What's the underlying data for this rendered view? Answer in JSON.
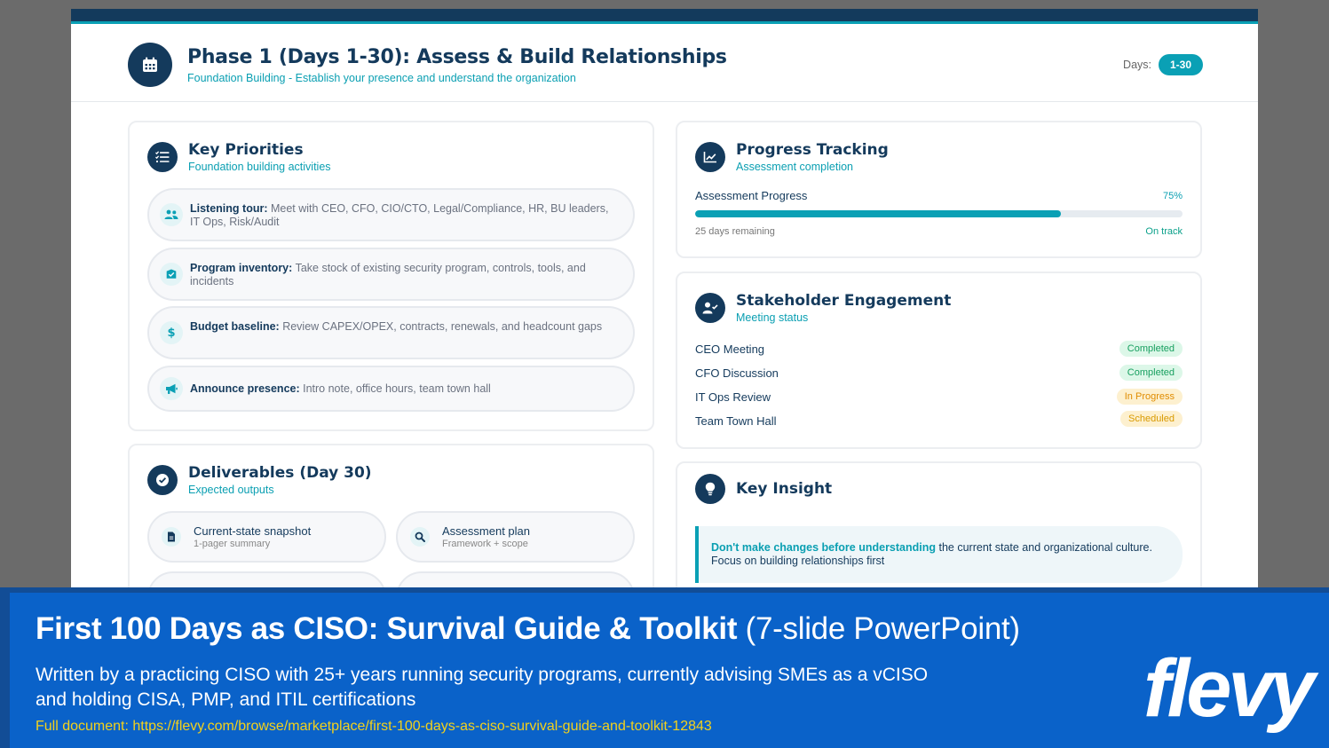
{
  "header": {
    "title": "Phase 1 (Days 1-30): Assess & Build Relationships",
    "subtitle": "Foundation Building - Establish your presence and understand the organization",
    "days_label": "Days:",
    "days_value": "1-30",
    "icon": "calendar-icon"
  },
  "priorities": {
    "title": "Key Priorities",
    "subtitle": "Foundation building activities",
    "icon": "checklist-icon",
    "items": [
      {
        "label": "Listening tour:",
        "text": "Meet with CEO, CFO, CIO/CTO, Legal/Compliance, HR, BU leaders, IT Ops, Risk/Audit",
        "icon": "users-icon"
      },
      {
        "label": "Program inventory:",
        "text": "Take stock of existing security program, controls, tools, and incidents",
        "icon": "shield-check-icon"
      },
      {
        "label": "Budget baseline:",
        "text": "Review CAPEX/OPEX, contracts, renewals, and headcount gaps",
        "icon": "dollar-icon"
      },
      {
        "label": "Announce presence:",
        "text": "Intro note, office hours, team town hall",
        "icon": "megaphone-icon"
      }
    ]
  },
  "deliverables": {
    "title": "Deliverables (Day 30)",
    "subtitle": "Expected outputs",
    "icon": "check-circle-icon",
    "items": [
      {
        "title": "Current-state snapshot",
        "sub": "1-pager summary",
        "icon": "document-icon"
      },
      {
        "title": "Assessment plan",
        "sub": "Framework + scope",
        "icon": "search-icon"
      }
    ]
  },
  "progress": {
    "title": "Progress Tracking",
    "subtitle": "Assessment completion",
    "icon": "chart-line-icon",
    "label": "Assessment Progress",
    "percent_text": "75%",
    "percent": 75,
    "remaining": "25 days remaining",
    "status": "On track"
  },
  "stakeholders": {
    "title": "Stakeholder Engagement",
    "subtitle": "Meeting status",
    "icon": "user-check-icon",
    "rows": [
      {
        "name": "CEO Meeting",
        "status": "Completed"
      },
      {
        "name": "CFO Discussion",
        "status": "Completed"
      },
      {
        "name": "IT Ops Review",
        "status": "In Progress"
      },
      {
        "name": "Team Town Hall",
        "status": "Scheduled"
      }
    ]
  },
  "insight": {
    "title": "Key Insight",
    "icon": "lightbulb-icon",
    "bold": "Don't make changes before understanding",
    "text": " the current state and organizational culture. Focus on building relationships first"
  },
  "banner": {
    "title_bold": "First 100 Days as CISO: Survival Guide & Toolkit",
    "title_light": " (7-slide PowerPoint)",
    "description": "Written by a practicing CISO with 25+ years running security programs, currently advising SMEs as a vCISO and holding CISA, PMP, and ITIL certifications",
    "link": "Full document: https://flevy.com/browse/marketplace/first-100-days-as-ciso-survival-guide-and-toolkit-12843",
    "logo": "flevy"
  },
  "colors": {
    "navy": "#143a5c",
    "teal": "#0aa0b5",
    "banner_blue": "#0a62c9",
    "link_yellow": "#f3d11b"
  }
}
